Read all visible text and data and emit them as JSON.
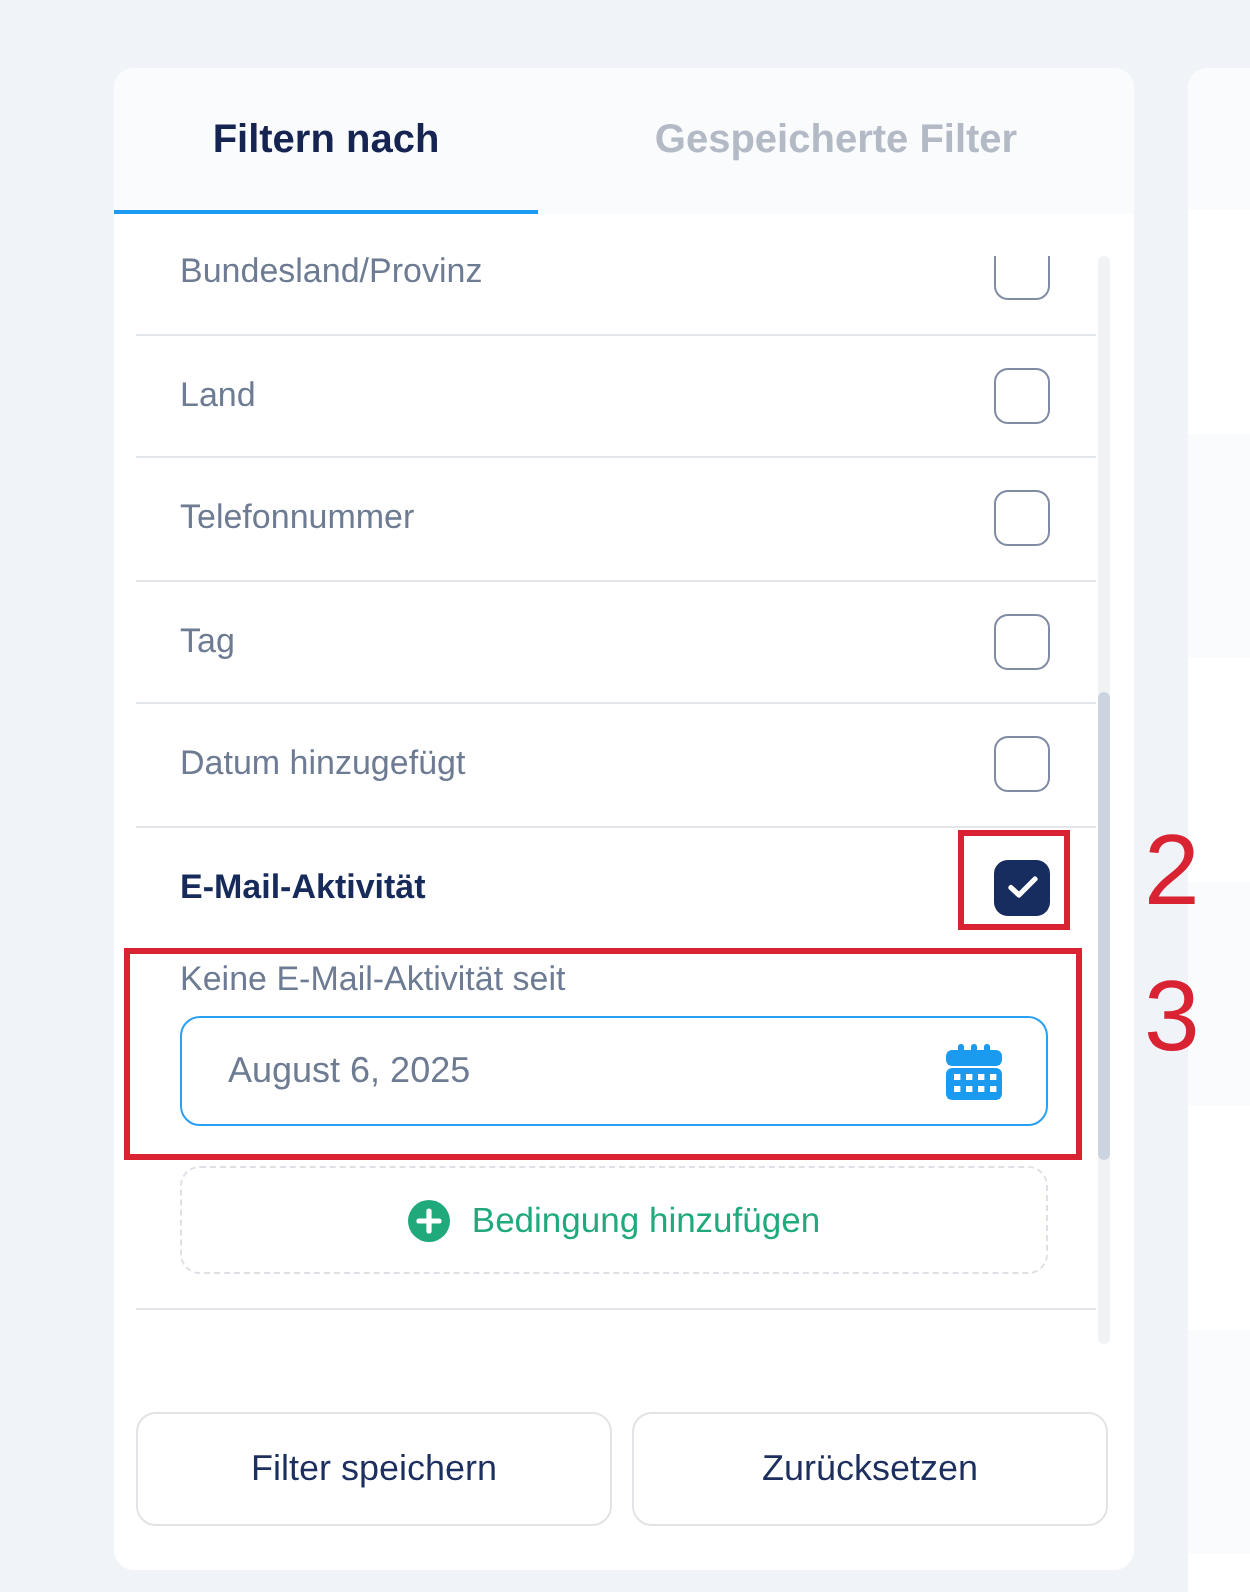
{
  "tabs": [
    {
      "label": "Filtern nach",
      "selected": true
    },
    {
      "label": "Gespeicherte Filter",
      "selected": false
    }
  ],
  "filters": [
    {
      "label": "Bundesland/Provinz",
      "checked": false
    },
    {
      "label": "Land",
      "checked": false
    },
    {
      "label": "Telefonnummer",
      "checked": false
    },
    {
      "label": "Tag",
      "checked": false
    },
    {
      "label": "Datum hinzugefügt",
      "checked": false
    },
    {
      "label": "E-Mail-Aktivität",
      "checked": true,
      "condition": {
        "label": "Keine E-Mail-Aktivität seit",
        "value": "August 6, 2025"
      },
      "add_condition": "Bedingung hinzufügen"
    }
  ],
  "buttons": [
    "Filter speichern",
    "Zurücksetzen"
  ],
  "annotations": [
    {
      "number": "2"
    },
    {
      "number": "3"
    }
  ]
}
